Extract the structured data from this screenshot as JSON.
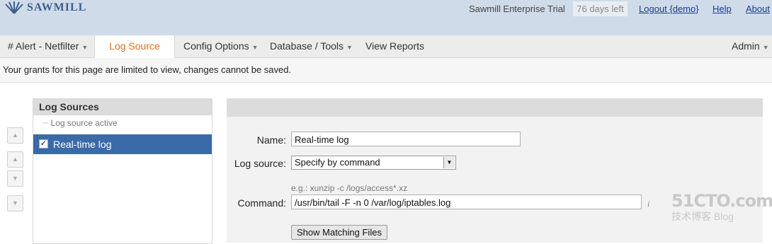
{
  "header": {
    "brand": "SAWMILL",
    "trial_text": "Sawmill Enterprise Trial",
    "days_left": "76 days left",
    "logout": "Logout {demo}",
    "help": "Help",
    "about": "About"
  },
  "nav": {
    "profile": "# Alert - Netfilter",
    "log_source": "Log Source",
    "config_options": "Config Options",
    "database_tools": "Database / Tools",
    "view_reports": "View Reports",
    "admin": "Admin"
  },
  "notice": "Your grants for this page are limited to view, changes cannot be saved.",
  "log_sources_panel": {
    "title": "Log Sources",
    "active_label": "Log source active",
    "items": [
      {
        "label": "Real-time log",
        "checked": true
      }
    ]
  },
  "form": {
    "name_label": "Name:",
    "name_value": "Real-time log",
    "source_label": "Log source:",
    "source_value": "Specify by command",
    "example": "e.g.: xunzip -c /logs/access*.xz",
    "command_label": "Command:",
    "command_value": "/usr/bin/tail -F -n 0 /var/log/iptables.log",
    "button": "Show Matching Files"
  },
  "watermark": {
    "main": "51CTO.com",
    "sub": "技术博客 Blog"
  },
  "colors": {
    "accent": "#e07020",
    "selected_row": "#3a6aa8",
    "header_bg": "#cfdbe9"
  }
}
